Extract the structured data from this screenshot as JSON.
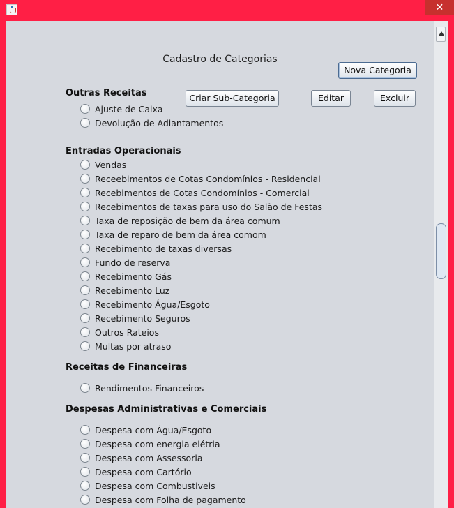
{
  "window": {
    "close_glyph": "✕",
    "app_icon": "java-cup-icon"
  },
  "title": "Cadastro de Categorias",
  "buttons": {
    "nova_categoria": "Nova Categoria",
    "criar_sub": "Criar Sub-Categoria",
    "editar": "Editar",
    "excluir": "Excluir"
  },
  "sections": [
    {
      "title": "Outras Receitas",
      "items": [
        "Ajuste de Caixa",
        "Devolução de Adiantamentos"
      ]
    },
    {
      "title": "Entradas Operacionais",
      "items": [
        "Vendas",
        "Receebimentos de Cotas Condomínios - Residencial",
        "Recebimentos de Cotas Condomínios - Comercial",
        "Recebimentos de taxas para uso do Salão de Festas",
        "Taxa de reposição de bem da área comum",
        "Taxa de reparo de bem da área comom",
        "Recebimento de taxas diversas",
        "Fundo de reserva",
        "Recebimento Gás",
        "Recebimento Luz",
        "Recebimento Água/Esgoto",
        "Recebimento Seguros",
        "Outros Rateios",
        "Multas por atraso"
      ]
    },
    {
      "title": "Receitas de Financeiras",
      "items": [
        "Rendimentos Financeiros"
      ]
    },
    {
      "title": "Despesas Administrativas e Comerciais",
      "items": [
        "Despesa com Água/Esgoto",
        "Despesa com energia elétria",
        "Despesa com Assessoria",
        "Despesa com Cartório",
        "Despesa com Combustiveis",
        " Despesa com Folha de pagamento"
      ]
    }
  ]
}
